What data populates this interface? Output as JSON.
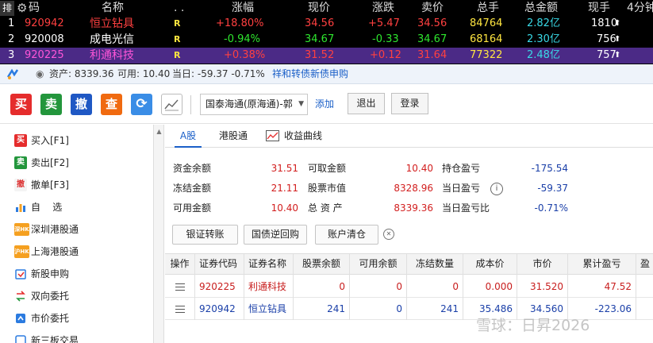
{
  "quote": {
    "sort_label": "排",
    "headers": [
      "码",
      "名称",
      ". .",
      "涨幅",
      "现价",
      "涨跌",
      "卖价",
      "总手",
      "总金额",
      "现手",
      "4分钟"
    ],
    "rows": [
      {
        "idx": "1",
        "code": "920942",
        "name": "恒立钻具",
        "flag": "R",
        "pct": "+18.80%",
        "price": "34.56",
        "change": "+5.47",
        "ask": "34.56",
        "volume": "84764",
        "amount": "2.82亿",
        "last_vol": "1810",
        "arrow": "⬆"
      },
      {
        "idx": "2",
        "code": "920008",
        "name": "成电光信",
        "flag": "R",
        "pct": "-0.94%",
        "price": "34.67",
        "change": "-0.33",
        "ask": "34.67",
        "volume": "68164",
        "amount": "2.30亿",
        "last_vol": "756",
        "arrow": "⬆"
      },
      {
        "idx": "3",
        "code": "920225",
        "name": "利通科技",
        "flag": "R",
        "pct": "+0.38%",
        "price": "31.52",
        "change": "+0.12",
        "ask": "31.64",
        "volume": "77322",
        "amount": "2.48亿",
        "last_vol": "757",
        "arrow": "⬆"
      }
    ]
  },
  "account_bar": {
    "assets": "资产: 8339.36",
    "available": "可用: 10.40",
    "today": "当日: -59.37 -0.71%",
    "link": "祥和转债新债申购"
  },
  "toolbar": {
    "buy": "买",
    "sell": "卖",
    "cancel": "撤",
    "query": "查",
    "broker": "国泰海通(原海通)-郭",
    "add": "添加",
    "exit": "退出",
    "login": "登录"
  },
  "sidebar": {
    "items": [
      {
        "icon": "买",
        "label": "买入[F1]"
      },
      {
        "icon": "卖",
        "label": "卖出[F2]"
      },
      {
        "icon": "撤",
        "label": "撤单[F3]"
      },
      {
        "icon": "",
        "label": "自    选"
      },
      {
        "icon": "深HK",
        "label": "深圳港股通"
      },
      {
        "icon": "沪HK",
        "label": "上海港股通"
      },
      {
        "icon": "",
        "label": "新股申购"
      },
      {
        "icon": "",
        "label": "双向委托"
      },
      {
        "icon": "",
        "label": "市价委托"
      },
      {
        "icon": "",
        "label": "新三板交易"
      }
    ]
  },
  "tabs": [
    "A股",
    "港股通",
    "收益曲线"
  ],
  "balances": {
    "fund_balance_label": "资金余额",
    "fund_balance": "31.51",
    "withdrawable_label": "可取金额",
    "withdrawable": "10.40",
    "holding_pl_label": "持仓盈亏",
    "holding_pl": "-175.54",
    "frozen_label": "冻结金额",
    "frozen": "21.11",
    "market_value_label": "股票市值",
    "market_value": "8328.96",
    "today_pl_label": "当日盈亏",
    "today_pl": "-59.37",
    "available_label": "可用金额",
    "available": "10.40",
    "total_assets_label": "总 资 产",
    "total_assets": "8339.36",
    "today_pl_pct_label": "当日盈亏比",
    "today_pl_pct": "-0.71%"
  },
  "actions": [
    "银证转账",
    "国债逆回购",
    "账户清仓"
  ],
  "positions": {
    "headers": [
      "操作",
      "证券代码",
      "证券名称",
      "股票余额",
      "可用余额",
      "冻结数量",
      "成本价",
      "市价",
      "累计盈亏",
      "盈"
    ],
    "rows": [
      {
        "code": "920225",
        "name": "利通科技",
        "qty": "0",
        "avail": "0",
        "frozen": "0",
        "cost": "0.000",
        "mkt": "31.520",
        "pl": "47.52",
        "color": "red"
      },
      {
        "code": "920942",
        "name": "恒立钻具",
        "qty": "241",
        "avail": "0",
        "frozen": "241",
        "cost": "35.486",
        "mkt": "34.560",
        "pl": "-223.06",
        "color": "blue"
      }
    ]
  },
  "watermark": "雪球：日昇2026",
  "colors": {
    "buy": "#e52c2c",
    "sell": "#23963c",
    "cancel": "#1f58c4",
    "query": "#f06a10",
    "up": "#ff4040",
    "down": "#2ee62e",
    "highlight_row": "#4b2a86"
  }
}
